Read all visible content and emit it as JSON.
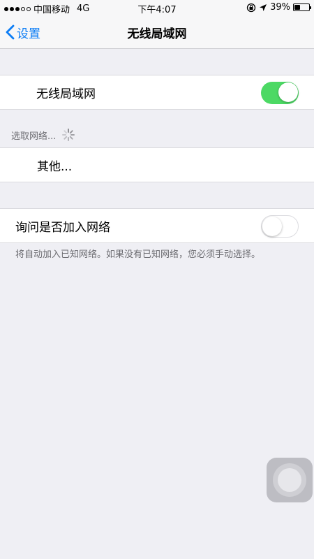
{
  "status_bar": {
    "carrier": "中国移动",
    "network": "4G",
    "time": "下午4:07",
    "battery_percent": "39%",
    "battery_level": 0.39,
    "signal_strength": 3,
    "icons": [
      "orientation-lock-icon",
      "location-icon",
      "battery-icon"
    ]
  },
  "nav": {
    "back_label": "设置",
    "title": "无线局域网"
  },
  "wifi_cell": {
    "label": "无线局域网",
    "enabled": true
  },
  "networks_section": {
    "header": "选取网络..."
  },
  "other_cell": {
    "label": "其他..."
  },
  "ask_join_cell": {
    "label": "询问是否加入网络",
    "enabled": false
  },
  "footer": {
    "text": "将自动加入已知网络。如果没有已知网络，您必须手动选择。"
  },
  "colors": {
    "accent": "#0a7cf5",
    "toggle_on": "#4cd964",
    "background": "#efeff4"
  }
}
